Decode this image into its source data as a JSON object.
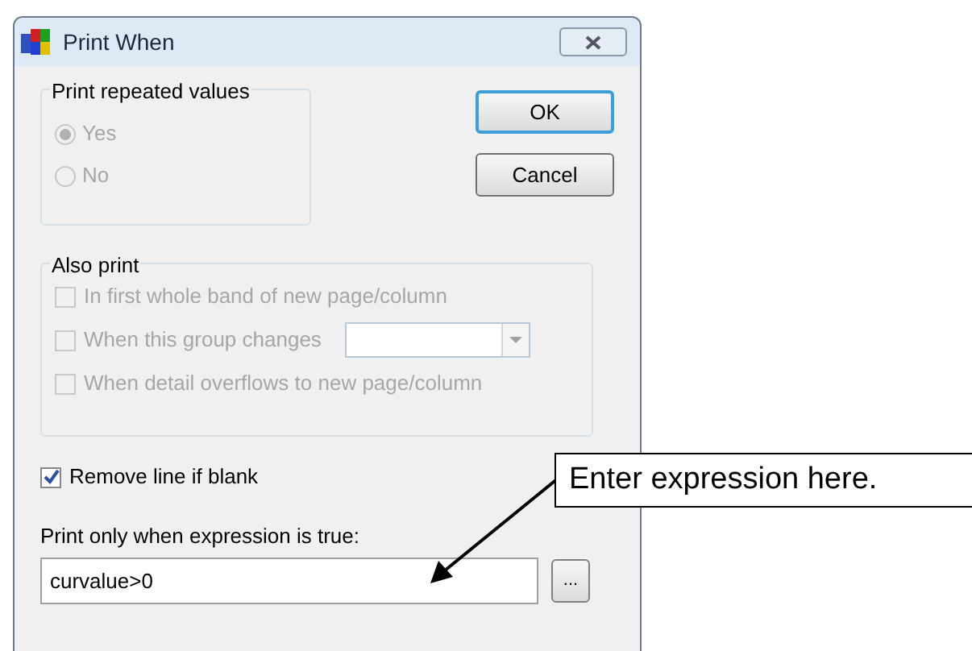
{
  "window": {
    "title": "Print When"
  },
  "repeat_group": {
    "title": "Print repeated values",
    "options": [
      {
        "label": "Yes",
        "selected": true,
        "disabled": true
      },
      {
        "label": "No",
        "selected": false,
        "disabled": true
      }
    ]
  },
  "buttons": [
    {
      "label": "OK",
      "default": true
    },
    {
      "label": "Cancel",
      "default": false
    }
  ],
  "also_print": {
    "title": "Also print",
    "options": [
      {
        "label": "In first whole band of new page/column",
        "checked": false,
        "disabled": true,
        "kind": "checkbox"
      },
      {
        "label": "When this group changes",
        "checked": false,
        "disabled": true,
        "kind": "combo"
      },
      {
        "label": "When detail overflows to new page/column",
        "checked": false,
        "disabled": true,
        "kind": "checkbox"
      }
    ]
  },
  "remove_line": {
    "label": "Remove line if blank",
    "checked": true,
    "disabled": false
  },
  "expression": {
    "label": "Print only when expression is true:",
    "value": "curvalue>0",
    "browse": "..."
  },
  "callout": {
    "text": "Enter expression here."
  }
}
